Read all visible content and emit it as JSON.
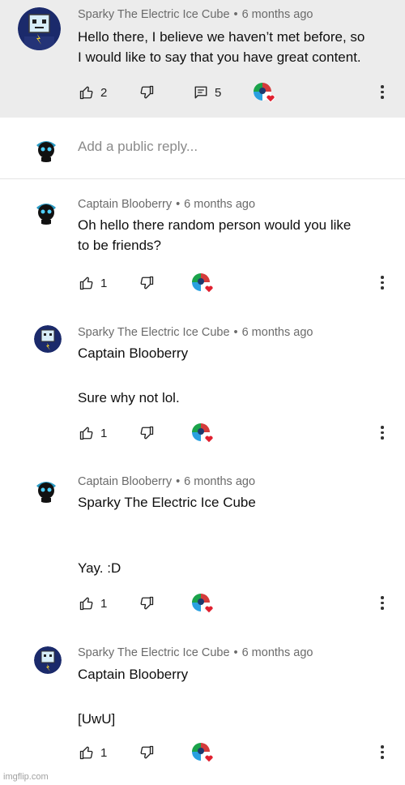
{
  "thread": {
    "top_comment": {
      "author": "Sparky The Electric Ice Cube",
      "separator": "•",
      "time": "6 months ago",
      "lines": [
        "Hello there, I believe we haven’t met before, so",
        "I would like to say that you have great content."
      ],
      "likes": "2",
      "replies": "5"
    },
    "reply_placeholder": "Add a public reply...",
    "replies": [
      {
        "author": "Captain Blooberry",
        "separator": "•",
        "time": "6 months ago",
        "lines": [
          "Oh hello there random person would you like",
          "to be friends?"
        ],
        "likes": "1"
      },
      {
        "author": "Sparky The Electric Ice Cube",
        "separator": "•",
        "time": "6 months ago",
        "lines": [
          "Captain Blooberry",
          "",
          "Sure why not lol."
        ],
        "likes": "1"
      },
      {
        "author": "Captain Blooberry",
        "separator": "•",
        "time": "6 months ago",
        "lines": [
          "Sparky The Electric Ice Cube",
          "",
          "",
          "Yay. :D"
        ],
        "likes": "1"
      },
      {
        "author": "Sparky The Electric Ice Cube",
        "separator": "•",
        "time": "6 months ago",
        "lines": [
          "Captain Blooberry",
          "",
          "[UwU]"
        ],
        "likes": "1"
      }
    ]
  },
  "icons": {
    "like": "thumbs-up-icon",
    "dislike": "thumbs-down-icon",
    "replies": "comment-icon",
    "creator_heart": "creator-heart-icon",
    "menu": "more-vertical-icon"
  },
  "colors": {
    "highlight_bg": "#ececec",
    "heart": "#e0202f",
    "meta_text": "#6b6b6b"
  },
  "watermark": "imgflip.com"
}
